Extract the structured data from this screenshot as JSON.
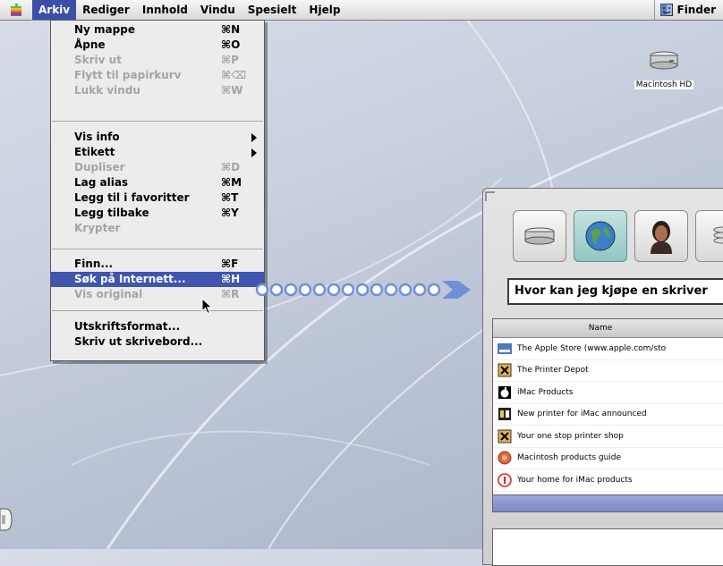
{
  "menubar": {
    "items": [
      "Arkiv",
      "Rediger",
      "Innhold",
      "Vindu",
      "Spesielt",
      "Hjelp"
    ],
    "active_index": 0,
    "app_menu_label": "Finder"
  },
  "file_menu": {
    "items": [
      {
        "label": "Ny mappe",
        "shortcut": "⌘N",
        "enabled": true
      },
      {
        "label": "Åpne",
        "shortcut": "⌘O",
        "enabled": true
      },
      {
        "label": "Skriv ut",
        "shortcut": "⌘P",
        "enabled": false
      },
      {
        "label": "Flytt til papirkurv",
        "shortcut": "⌘⌫",
        "enabled": false
      },
      {
        "label": "Lukk vindu",
        "shortcut": "⌘W",
        "enabled": false
      },
      {
        "label": "Vis info",
        "shortcut": "",
        "enabled": true,
        "submenu": true
      },
      {
        "label": "Etikett",
        "shortcut": "",
        "enabled": true,
        "submenu": true
      },
      {
        "label": "Dupliser",
        "shortcut": "⌘D",
        "enabled": false
      },
      {
        "label": "Lag alias",
        "shortcut": "⌘M",
        "enabled": true
      },
      {
        "label": "Legg til i favoritter",
        "shortcut": "⌘T",
        "enabled": true
      },
      {
        "label": "Legg tilbake",
        "shortcut": "⌘Y",
        "enabled": true
      },
      {
        "label": "Krypter",
        "shortcut": "",
        "enabled": false
      },
      {
        "label": "Finn...",
        "shortcut": "⌘F",
        "enabled": true
      },
      {
        "label": "Søk på Internett...",
        "shortcut": "⌘H",
        "enabled": true,
        "highlighted": true
      },
      {
        "label": "Vis original",
        "shortcut": "⌘R",
        "enabled": false
      },
      {
        "label": "Utskriftsformat...",
        "shortcut": "",
        "enabled": true
      },
      {
        "label": "Skriv ut skrivebord...",
        "shortcut": "",
        "enabled": true
      }
    ]
  },
  "desktop": {
    "hd_label": "Macintosh HD"
  },
  "sherlock": {
    "query": "Hvor kan jeg kjøpe en skriver",
    "column_header": "Name",
    "results": [
      {
        "icon": "apple-store-icon",
        "title": "The Apple Store (www.apple.com/sto"
      },
      {
        "icon": "printer-icon",
        "title": "The Printer Depot"
      },
      {
        "icon": "apple-icon",
        "title": "iMac Products"
      },
      {
        "icon": "news-icon",
        "title": "New printer for iMac announced"
      },
      {
        "icon": "printer-icon",
        "title": "Your one stop printer shop"
      },
      {
        "icon": "globe-icon",
        "title": "Macintosh products guide"
      },
      {
        "icon": "info-icon",
        "title": "Your home for iMac products"
      }
    ]
  },
  "colors": {
    "menu_highlight": "#3f55b0",
    "arrow_blue": "#6f8fd8"
  }
}
